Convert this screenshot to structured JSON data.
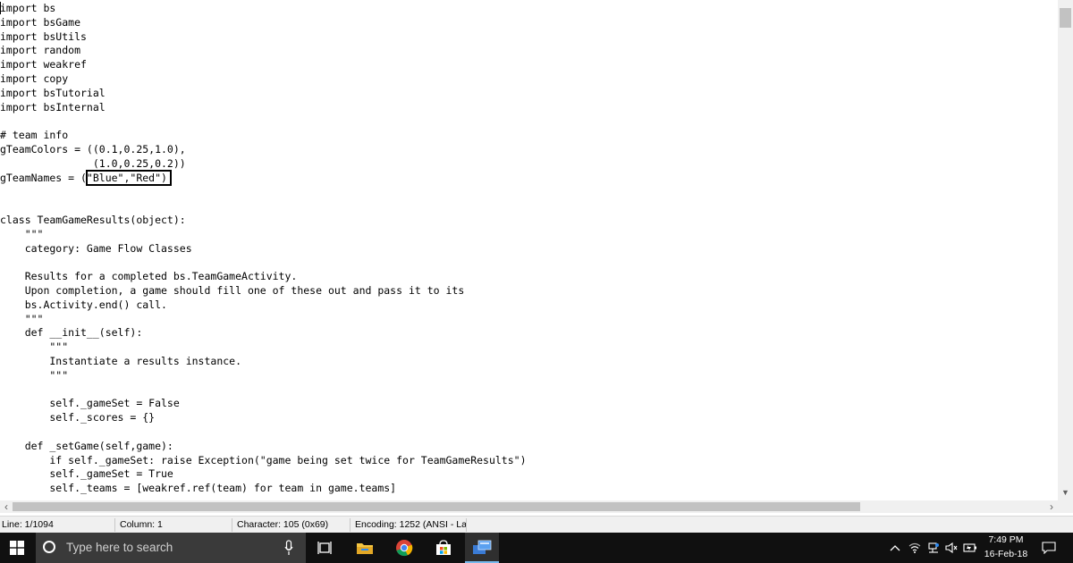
{
  "editor": {
    "lines": [
      "import bs",
      "import bsGame",
      "import bsUtils",
      "import random",
      "import weakref",
      "import copy",
      "import bsTutorial",
      "import bsInternal",
      "",
      "# team info",
      "gTeamColors = ((0.1,0.25,1.0),",
      "               (1.0,0.25,0.2))",
      "gTeamNames = (\"Blue\",\"Red\")",
      "",
      "",
      "class TeamGameResults(object):",
      "    \"\"\"",
      "    category: Game Flow Classes",
      "",
      "    Results for a completed bs.TeamGameActivity.",
      "    Upon completion, a game should fill one of these out and pass it to its",
      "    bs.Activity.end() call.",
      "    \"\"\"",
      "    def __init__(self):",
      "        \"\"\"",
      "        Instantiate a results instance.",
      "        \"\"\"",
      "",
      "        self._gameSet = False",
      "        self._scores = {}",
      "",
      "    def _setGame(self,game):",
      "        if self._gameSet: raise Exception(\"game being set twice for TeamGameResults\")",
      "        self._gameSet = True",
      "        self._teams = [weakref.ref(team) for team in game.teams]"
    ]
  },
  "statusbar": {
    "line": "Line: 1/1094",
    "column": "Column: 1",
    "character": "Character: 105 (0x69)",
    "encoding": "Encoding: 1252  (ANSI - La"
  },
  "taskbar": {
    "search_placeholder": "Type here to search",
    "time": "7:49 PM",
    "date": "16-Feb-18",
    "icons": [
      "windows-start-icon",
      "search-icon",
      "microphone-icon",
      "task-view-icon",
      "file-explorer-icon",
      "chrome-icon",
      "store-icon",
      "app-icon",
      "chevron-up-icon",
      "wifi-icon",
      "network-icon",
      "volume-icon",
      "battery-icon",
      "notification-icon"
    ]
  },
  "colors": {
    "taskbar_bg": "#101010",
    "search_bg": "#3a3a3a",
    "accent_underline": "#76b9ed",
    "statusbar_bg": "#f0f0f0"
  }
}
